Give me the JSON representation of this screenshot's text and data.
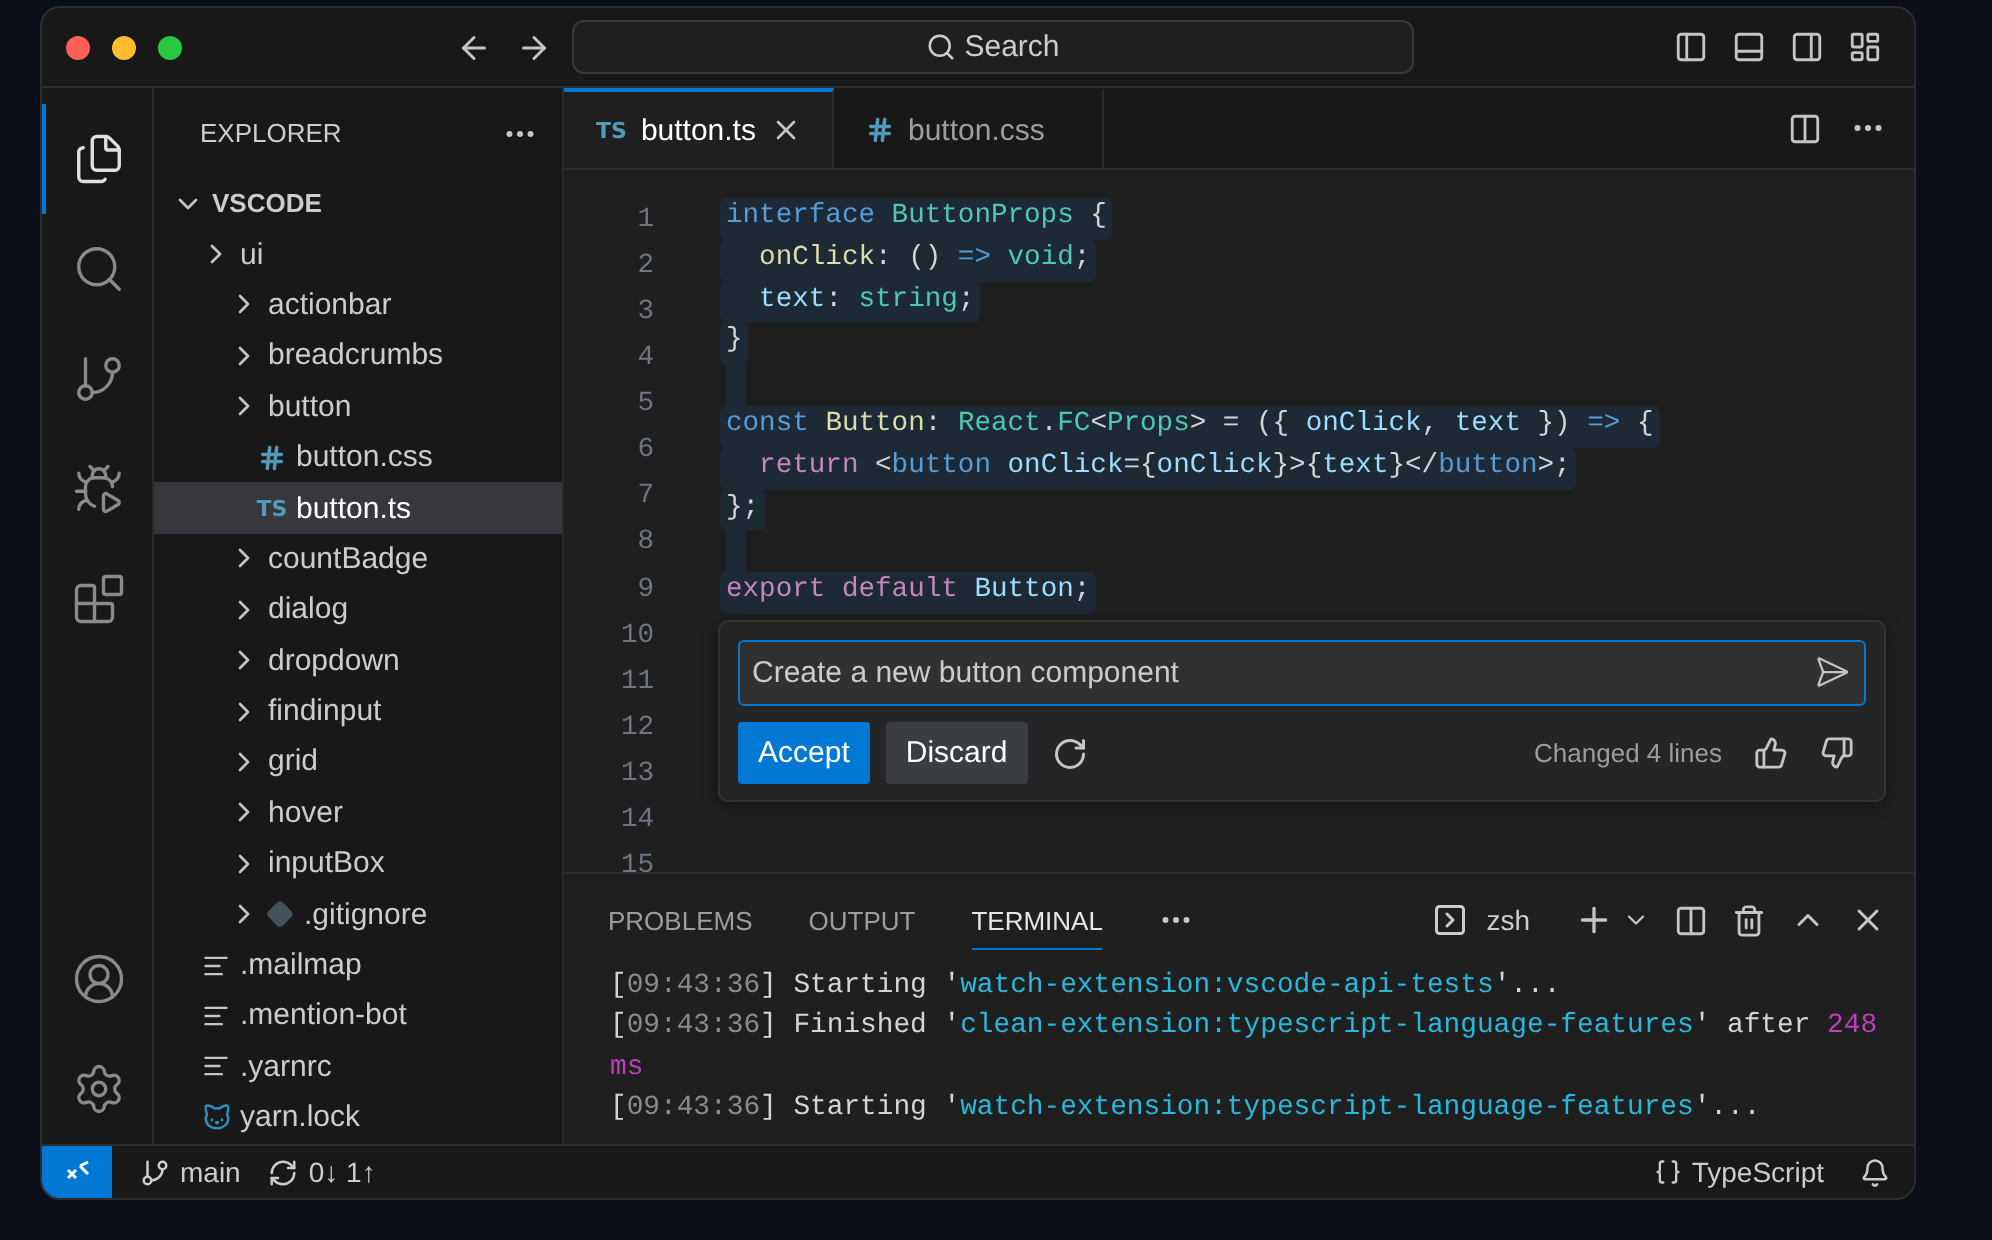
{
  "command_center": {
    "label": "Search"
  },
  "activity_bar": {
    "items": [
      {
        "kind": "files",
        "selected": true
      },
      {
        "kind": "search",
        "selected": false
      },
      {
        "kind": "source-control",
        "selected": false
      },
      {
        "kind": "run-debug",
        "selected": false
      },
      {
        "kind": "extensions",
        "selected": false
      }
    ],
    "bottom": [
      {
        "kind": "account"
      },
      {
        "kind": "settings"
      }
    ]
  },
  "sidebar": {
    "title": "EXPLORER",
    "tree": [
      {
        "label": "VSCODE",
        "kind": "root",
        "expanded": true,
        "selected": false,
        "children": [
          {
            "label": "ui",
            "kind": "folder",
            "expanded": false,
            "selected": false,
            "children": [
              {
                "label": "actionbar",
                "kind": "folder",
                "expanded": false,
                "selected": false
              },
              {
                "label": "breadcrumbs",
                "kind": "folder",
                "expanded": false,
                "selected": false
              },
              {
                "label": "button",
                "kind": "folder",
                "expanded": false,
                "selected": false,
                "children": [
                  {
                    "label": "button.css",
                    "kind": "css",
                    "selected": false
                  },
                  {
                    "label": "button.ts",
                    "kind": "ts",
                    "icon_text": "TS",
                    "selected": true
                  }
                ]
              },
              {
                "label": "countBadge",
                "kind": "folder",
                "expanded": false,
                "selected": false
              },
              {
                "label": "dialog",
                "kind": "folder",
                "expanded": false,
                "selected": false
              },
              {
                "label": "dropdown",
                "kind": "folder",
                "expanded": false,
                "selected": false
              },
              {
                "label": "findinput",
                "kind": "folder",
                "expanded": false,
                "selected": false
              },
              {
                "label": "grid",
                "kind": "folder",
                "expanded": false,
                "selected": false
              },
              {
                "label": "hover",
                "kind": "folder",
                "expanded": false,
                "selected": false
              },
              {
                "label": "inputBox",
                "kind": "folder",
                "expanded": false,
                "selected": false
              },
              {
                "label": ".gitignore",
                "kind": "git",
                "expanded": false,
                "selected": false
              }
            ]
          },
          {
            "label": ".mailmap",
            "kind": "text",
            "selected": false
          },
          {
            "label": ".mention-bot",
            "kind": "text",
            "selected": false
          },
          {
            "label": ".yarnrc",
            "kind": "text",
            "selected": false
          },
          {
            "label": "yarn.lock",
            "kind": "yarn",
            "selected": false
          }
        ]
      }
    ]
  },
  "editor_tabs": [
    {
      "label": "button.ts",
      "kind": "ts",
      "icon_text": "TS",
      "selected": true
    },
    {
      "label": "button.css",
      "kind": "css",
      "selected": false
    }
  ],
  "line_numbers": [
    "1",
    "2",
    "3",
    "4",
    "5",
    "6",
    "7",
    "8",
    "9",
    "10",
    "11",
    "12",
    "13",
    "14",
    "15"
  ],
  "code_lines": [
    {
      "highlighted": true,
      "tokens": [
        {
          "text": "interface ",
          "kind": "keyword"
        },
        {
          "text": "ButtonProps",
          "kind": "type"
        },
        {
          "text": " {",
          "kind": "plain"
        }
      ]
    },
    {
      "highlighted": true,
      "tokens": [
        {
          "text": "  onClick",
          "kind": "func"
        },
        {
          "text": ": () ",
          "kind": "plain"
        },
        {
          "text": "=>",
          "kind": "keyword"
        },
        {
          "text": " void",
          "kind": "type"
        },
        {
          "text": ";",
          "kind": "plain"
        }
      ]
    },
    {
      "highlighted": true,
      "tokens": [
        {
          "text": "  text",
          "kind": "var"
        },
        {
          "text": ": ",
          "kind": "plain"
        },
        {
          "text": "string",
          "kind": "type"
        },
        {
          "text": ";",
          "kind": "plain"
        }
      ]
    },
    {
      "highlighted": true,
      "tokens": [
        {
          "text": "}",
          "kind": "plain"
        }
      ]
    },
    {
      "highlighted": true
    },
    {
      "highlighted": true,
      "tokens": [
        {
          "text": "const ",
          "kind": "keyword"
        },
        {
          "text": "Button",
          "kind": "func"
        },
        {
          "text": ": ",
          "kind": "plain"
        },
        {
          "text": "React",
          "kind": "type"
        },
        {
          "text": ".",
          "kind": "plain"
        },
        {
          "text": "FC",
          "kind": "type"
        },
        {
          "text": "<",
          "kind": "plain"
        },
        {
          "text": "Props",
          "kind": "type"
        },
        {
          "text": "> = ({ ",
          "kind": "plain"
        },
        {
          "text": "onClick",
          "kind": "var"
        },
        {
          "text": ", ",
          "kind": "plain"
        },
        {
          "text": "text",
          "kind": "var"
        },
        {
          "text": " }) ",
          "kind": "plain"
        },
        {
          "text": "=>",
          "kind": "keyword"
        },
        {
          "text": " {",
          "kind": "plain"
        }
      ]
    },
    {
      "highlighted": true,
      "tokens": [
        {
          "text": "  return ",
          "kind": "control"
        },
        {
          "text": "<",
          "kind": "plain"
        },
        {
          "text": "button ",
          "kind": "keyword"
        },
        {
          "text": "onClick",
          "kind": "var"
        },
        {
          "text": "={",
          "kind": "plain"
        },
        {
          "text": "onClick",
          "kind": "var"
        },
        {
          "text": "}>{",
          "kind": "plain"
        },
        {
          "text": "text",
          "kind": "var"
        },
        {
          "text": "}</",
          "kind": "plain"
        },
        {
          "text": "button",
          "kind": "keyword"
        },
        {
          "text": ">;",
          "kind": "plain"
        }
      ]
    },
    {
      "highlighted": true,
      "tokens": [
        {
          "text": "};",
          "kind": "plain"
        }
      ]
    },
    {
      "highlighted": true
    },
    {
      "highlighted": true,
      "tokens": [
        {
          "text": "export default ",
          "kind": "control"
        },
        {
          "text": "Button",
          "kind": "var"
        },
        {
          "text": ";",
          "kind": "plain"
        }
      ]
    }
  ],
  "inline_chat": {
    "value": "Create a new button component",
    "buttons": [
      {
        "label": "Accept",
        "kind": "primary"
      },
      {
        "label": "Discard",
        "kind": "secondary"
      }
    ],
    "status": "Changed 4 lines"
  },
  "panel": {
    "tabs": [
      {
        "label": "PROBLEMS",
        "selected": false
      },
      {
        "label": "OUTPUT",
        "selected": false
      },
      {
        "label": "TERMINAL",
        "selected": true
      }
    ],
    "shell": "zsh",
    "lines": [
      [
        {
          "text": "[",
          "kind": "plain"
        },
        {
          "text": "09:43:36",
          "kind": "time"
        },
        {
          "text": "] Starting '",
          "kind": "plain"
        },
        {
          "text": "watch-extension:vscode-api-tests",
          "kind": "string"
        },
        {
          "text": "'...",
          "kind": "plain"
        }
      ],
      [
        {
          "text": "[",
          "kind": "plain"
        },
        {
          "text": "09:43:36",
          "kind": "time"
        },
        {
          "text": "] Finished '",
          "kind": "plain"
        },
        {
          "text": "clean-extension:typescript-language-features",
          "kind": "string"
        },
        {
          "text": "' after ",
          "kind": "plain"
        },
        {
          "text": "248",
          "kind": "number"
        }
      ],
      [
        {
          "text": "ms",
          "kind": "number"
        }
      ],
      [
        {
          "text": "[",
          "kind": "plain"
        },
        {
          "text": "09:43:36",
          "kind": "time"
        },
        {
          "text": "] Starting '",
          "kind": "plain"
        },
        {
          "text": "watch-extension:typescript-language-features",
          "kind": "string"
        },
        {
          "text": "'...",
          "kind": "plain"
        }
      ]
    ]
  },
  "status_bar": {
    "branch": "main",
    "sync": "0↓ 1↑",
    "language": "TypeScript"
  }
}
